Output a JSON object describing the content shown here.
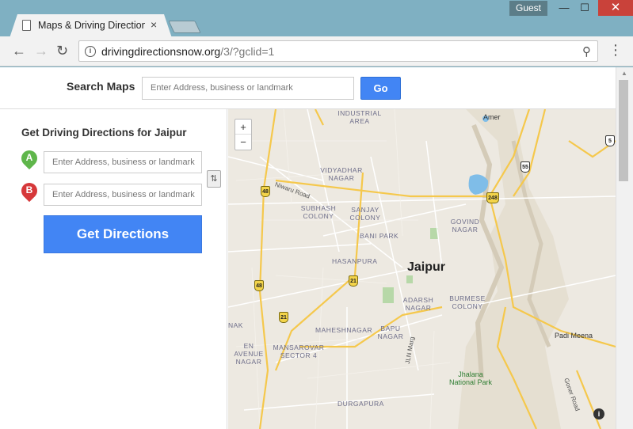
{
  "window": {
    "tab_title": "Maps & Driving Direction",
    "tab_close": "×",
    "profile": "Guest",
    "minimize": "—",
    "maximize": "☐",
    "close": "✕"
  },
  "toolbar": {
    "url_host": "drivingdirectionsnow.org",
    "url_path": "/3/?gclid=1",
    "back": "←",
    "forward": "→",
    "reload": "↻",
    "zoom_icon": "⚲",
    "menu": "⋮"
  },
  "search": {
    "label": "Search Maps",
    "placeholder": "Enter Address, business or landmark",
    "go_label": "Go"
  },
  "directions": {
    "title": "Get Driving Directions for Jaipur",
    "marker_a": "A",
    "marker_b": "B",
    "placeholder_a": "Enter Address, business or landmark",
    "placeholder_b": "Enter Address, business or landmark",
    "swap": "⇅",
    "button_label": "Get Directions"
  },
  "map": {
    "zoom_in": "+",
    "zoom_out": "−",
    "city": "Jaipur",
    "areas": {
      "industrial": "INDUSTRIAL AREA",
      "vidyadhar": "VIDYADHAR NAGAR",
      "subhash": "SUBHASH COLONY",
      "sanjay": "SANJAY COLONY",
      "bani": "BANI PARK",
      "govind": "GOVIND NAGAR",
      "hasanpura": "HASANPURA",
      "adarsh": "ADARSH NAGAR",
      "burmese": "BURMESE COLONY",
      "nak": "NAK",
      "maheshnagar": "MAHESHNAGAR",
      "bapu": "BAPU NAGAR",
      "avenue": "EN AVENUE NAGAR",
      "mansarovar": "MANSAROVAR SECTOR 4",
      "durgapura": "DURGAPURA"
    },
    "places": {
      "amer": "Amer",
      "padi": "Padi Meena"
    },
    "park": "Jhalana National Park",
    "roads": {
      "niwaru": "Niwaru Road",
      "jln": "JLN Marg",
      "goner": "Goner Road"
    },
    "shields": {
      "s48a": "48",
      "s48b": "48",
      "s21a": "21",
      "s21b": "21",
      "s248": "248",
      "s55": "55",
      "s5": "5"
    },
    "info": "i"
  },
  "scroll": {
    "up": "▲"
  },
  "colors": {
    "accent": "#4285f4",
    "marker_a": "#5fb64b",
    "marker_b": "#d6383a",
    "chrome_frame": "#7fb0c2"
  }
}
